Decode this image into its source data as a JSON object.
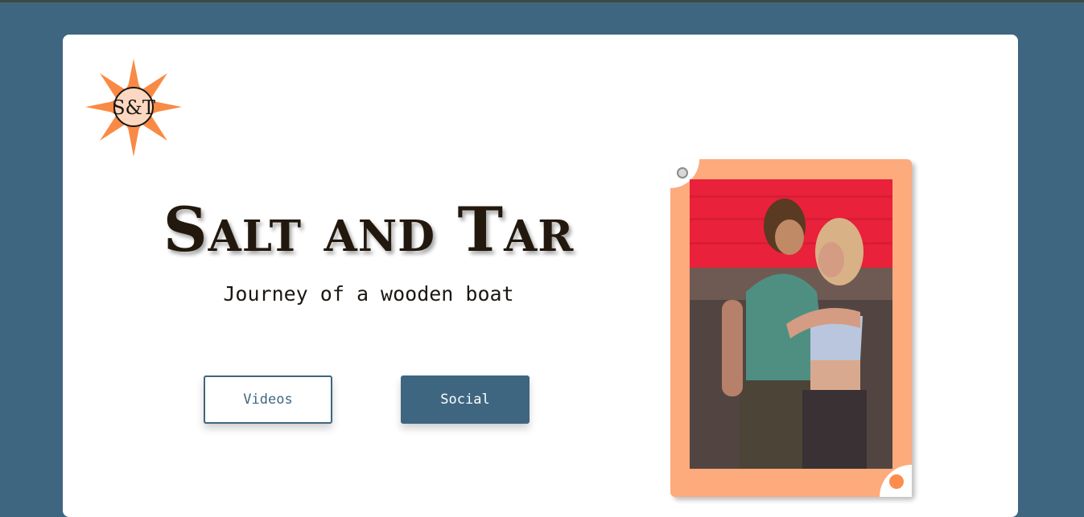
{
  "site": {
    "title": "Salt and Tar",
    "subtitle": "Journey of a wooden boat"
  },
  "logo": {
    "text": "S&T",
    "icon": "compass-star-logo-icon"
  },
  "buttons": {
    "videos_label": "Videos",
    "social_label": "Social"
  },
  "photo": {
    "alt": "couple-embracing-photo"
  },
  "colors": {
    "page_background": "#3e6680",
    "card_background": "#ffffff",
    "accent_orange": "#fdaa7d",
    "button_primary": "#3e6680",
    "title_text": "#22180d"
  }
}
